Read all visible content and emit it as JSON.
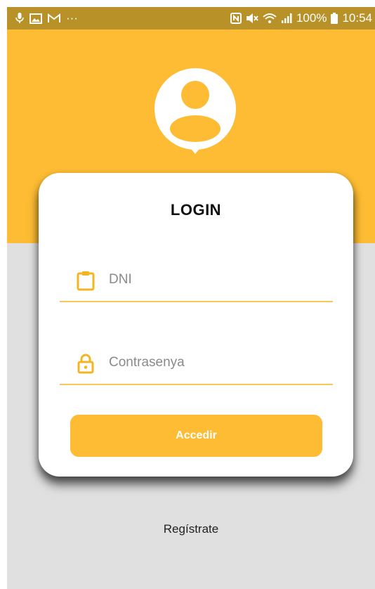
{
  "status_bar": {
    "left_icons": [
      "microphone-icon",
      "image-icon",
      "gmail-icon",
      "more-notifications-icon"
    ],
    "more_text": "···",
    "right_icons": [
      "nfc-icon",
      "mute-icon",
      "wifi-icon",
      "signal-icon"
    ],
    "battery": "100%",
    "time": "10:54"
  },
  "login": {
    "title": "LOGIN",
    "dni_placeholder": "DNI",
    "password_placeholder": "Contrasenya",
    "submit_label": "Accedir"
  },
  "register": {
    "label": "Regístrate"
  },
  "colors": {
    "accent": "#fdbc33",
    "status_bar": "#b89229",
    "background": "#e0e0e0",
    "field_underline": "#f6c95a"
  }
}
